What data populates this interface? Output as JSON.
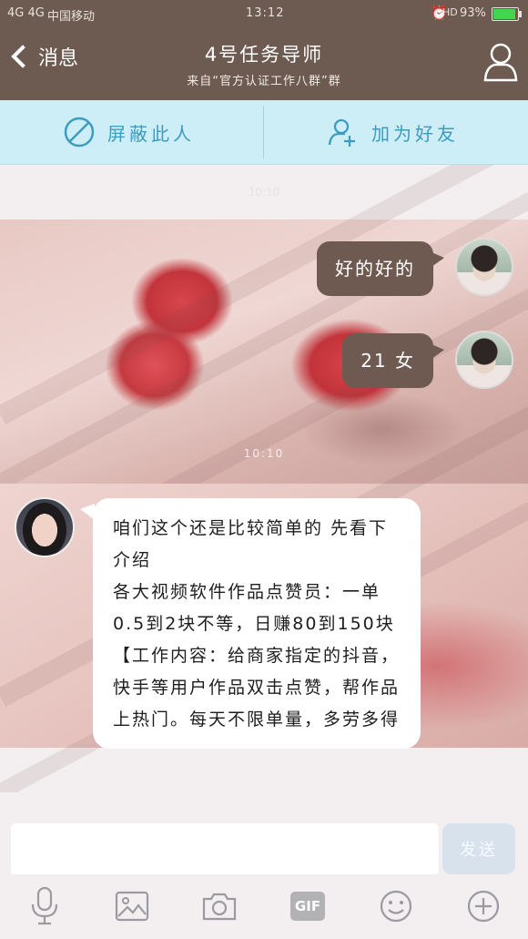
{
  "status_bar": {
    "signal": "4G 4G",
    "carrier": "中国移动",
    "time": "13:12",
    "hd": "HD",
    "battery": "93%",
    "battery_level": 0.93
  },
  "nav": {
    "back_label": "消息",
    "title": "4号任务导师",
    "subtitle": "来自“官方认证工作八群”群",
    "profile_icon": "person-icon"
  },
  "actions": {
    "block_label": "屏蔽此人",
    "add_friend_label": "加为好友"
  },
  "chat": {
    "faint_time": "10:10",
    "messages": [
      {
        "from": "me",
        "text": "好的好的"
      },
      {
        "from": "me",
        "text": "21 女"
      }
    ],
    "time_divider": "10:10",
    "incoming": {
      "lines": [
        "咱们这个还是比较简单的 先看下介绍",
        "各大视频软件作品点赞员：一单0.5到2块不等，日赚80到150块",
        "【工作内容：给商家指定的抖音，快手等用户作品双击点赞，帮作品上热门。每天不限单量，多劳多得"
      ]
    }
  },
  "input": {
    "value": "",
    "send_label": "发送"
  },
  "toolbar": {
    "items": [
      "mic-icon",
      "image-icon",
      "camera-icon",
      "gif-icon",
      "emoji-icon",
      "plus-icon"
    ],
    "gif_label": "GIF"
  },
  "colors": {
    "header": "#6d5a50",
    "action_bar": "#cdeef6",
    "action_text": "#3d9cc0",
    "my_bubble": "#6f5a52",
    "send_disabled": "#d8e2ec"
  }
}
